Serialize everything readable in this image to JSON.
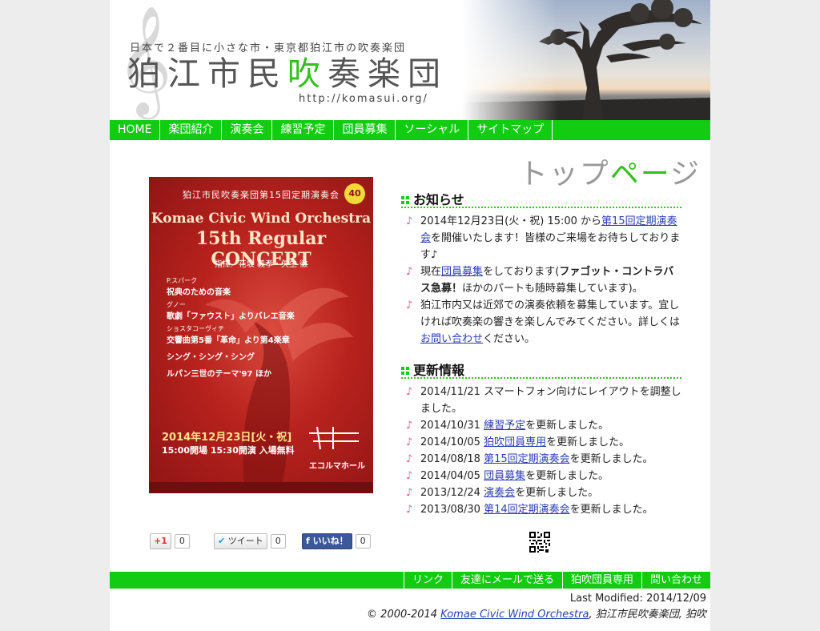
{
  "header": {
    "tagline": "日本で２番目に小さな市・東京都狛江市の吹奏楽団",
    "site_name_pre": "狛江市民",
    "site_name_accent": "吹",
    "site_name_post": "奏楽団",
    "url": "http://komasui.org/"
  },
  "nav": [
    "HOME",
    "楽団紹介",
    "演奏会",
    "練習予定",
    "団員募集",
    "ソーシャル",
    "サイトマップ"
  ],
  "page_title": {
    "pre": "トップ",
    "accent": "ペー",
    "post": "ジ"
  },
  "poster": {
    "org": "狛江市民吹奏楽団第15回定期演奏会",
    "en_name": "Komae Civic Wind Orchestra",
    "title": "15th Regular CONCERT",
    "conductors": "指揮／花坂 義孝・矢生 徹",
    "program": [
      "P.スパーク",
      "祝典のための音楽",
      "グノー",
      "歌劇「ファウスト」よりバレエ音楽",
      "ショスタコーヴィチ",
      "交響曲第5番「革命」より第4楽章",
      "シング・シング・シング",
      "ルパン三世のテーマ'97 ほか"
    ],
    "date": "2014年12月23日[火・祝]",
    "time": "15:00開場 15:30開演 入場無料",
    "venue": "エコルマホール",
    "anniv": "40"
  },
  "news": {
    "title": "お知らせ",
    "items": [
      {
        "parts": [
          {
            "t": "2014年12月23日(火・祝) 15:00 から"
          },
          {
            "t": "第15回定期演奏会",
            "link": true
          },
          {
            "t": "を開催いたします！皆様のご来場をお待ちしております♪"
          }
        ]
      },
      {
        "parts": [
          {
            "t": "現在"
          },
          {
            "t": "団員募集",
            "link": true
          },
          {
            "t": "をしております("
          },
          {
            "t": "ファゴット・コントラバス急募！",
            "bold": true
          },
          {
            "t": "ほかのパートも随時募集しています)。"
          }
        ]
      },
      {
        "parts": [
          {
            "t": "狛江市内又は近郊での演奏依頼を募集しています。宜しければ吹奏楽の響きを楽しんでみてください。詳しくは"
          },
          {
            "t": "お問い合わせ",
            "link": true
          },
          {
            "t": "ください。"
          }
        ]
      }
    ]
  },
  "updates": {
    "title": "更新情報",
    "items": [
      {
        "parts": [
          {
            "t": "2014/11/21 スマートフォン向けにレイアウトを調整しました。"
          }
        ]
      },
      {
        "parts": [
          {
            "t": "2014/10/31 "
          },
          {
            "t": "練習予定",
            "link": true
          },
          {
            "t": "を更新しました。"
          }
        ]
      },
      {
        "parts": [
          {
            "t": "2014/10/05 "
          },
          {
            "t": "狛吹団員専用",
            "link": true
          },
          {
            "t": "を更新しました。"
          }
        ]
      },
      {
        "parts": [
          {
            "t": "2014/08/18 "
          },
          {
            "t": "第15回定期演奏会",
            "link": true
          },
          {
            "t": "を更新しました。"
          }
        ]
      },
      {
        "parts": [
          {
            "t": "2014/04/05 "
          },
          {
            "t": "団員募集",
            "link": true
          },
          {
            "t": "を更新しました。"
          }
        ]
      },
      {
        "parts": [
          {
            "t": "2013/12/24 "
          },
          {
            "t": "演奏会",
            "link": true
          },
          {
            "t": "を更新しました。"
          }
        ]
      },
      {
        "parts": [
          {
            "t": "2013/08/30 "
          },
          {
            "t": "第14回定期演奏会",
            "link": true
          },
          {
            "t": "を更新しました。"
          }
        ]
      }
    ]
  },
  "social": {
    "gplus_label": "+1",
    "gplus_count": "0",
    "tweet_label": "ツイート",
    "tweet_count": "0",
    "like_label": "いいね！",
    "like_count": "0"
  },
  "footer": {
    "links": [
      "リンク",
      "友達にメールで送る",
      "狛吹団員専用",
      "問い合わせ"
    ],
    "modified": "Last Modified: 2014/12/09",
    "copyright_pre": "© 2000-2014 ",
    "copyright_link": "Komae Civic Wind Orchestra",
    "copyright_post": ", 狛江市民吹奏楽団, 狛吹"
  },
  "colors": {
    "accent": "#11cc11",
    "link": "#2a3fb3",
    "note": "#e35a8c"
  }
}
